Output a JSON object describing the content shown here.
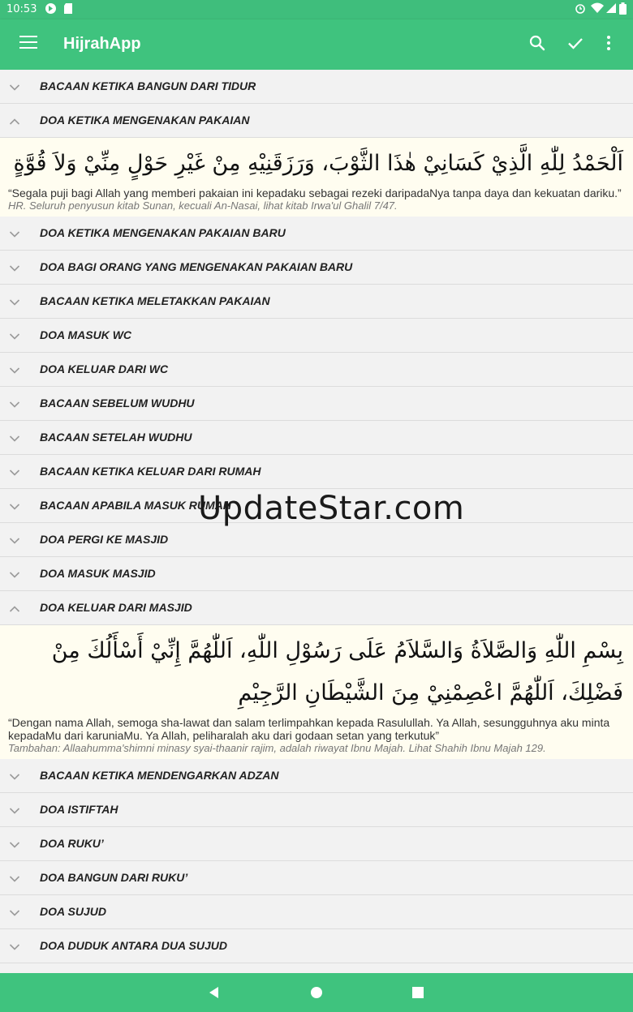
{
  "status_bar": {
    "time": "10:53",
    "icons": [
      "app-icon",
      "sd-card-icon",
      "alarm-icon",
      "wifi-icon",
      "signal-icon",
      "battery-icon"
    ]
  },
  "app_bar": {
    "title": "HijrahApp",
    "actions": [
      "search-icon",
      "check-icon",
      "more-vert-icon"
    ],
    "color": "#3fc37e"
  },
  "items": [
    {
      "label": "BACAAN KETIKA BANGUN DARI TIDUR",
      "expanded": false
    },
    {
      "label": "DOA KETIKA MENGENAKAN PAKAIAN",
      "expanded": true,
      "arabic": "اَلْحَمْدُ لِلّٰهِ الَّذِيْ كَسَانِيْ هٰذَا الثَّوْبَ، وَرَزَقَنِيْهِ مِنْ غَيْرِ حَوْلٍ مِنِّيْ وَلاَ قُوَّةٍ",
      "translation": "“Segala puji bagi Allah yang memberi pakaian ini kepadaku sebagai rezeki daripadaNya tanpa daya dan kekuatan dariku.”",
      "reference": "HR. Seluruh penyusun kitab Sunan, kecuali An-Nasai, lihat kitab Irwa'ul Ghalil 7/47."
    },
    {
      "label": "DOA KETIKA MENGENAKAN PAKAIAN BARU",
      "expanded": false
    },
    {
      "label": "DOA BAGI ORANG YANG MENGENAKAN PAKAIAN BARU",
      "expanded": false
    },
    {
      "label": "BACAAN KETIKA MELETAKKAN PAKAIAN",
      "expanded": false
    },
    {
      "label": "DOA MASUK WC",
      "expanded": false
    },
    {
      "label": "DOA KELUAR DARI WC",
      "expanded": false
    },
    {
      "label": "BACAAN SEBELUM WUDHU",
      "expanded": false
    },
    {
      "label": "BACAAN SETELAH WUDHU",
      "expanded": false
    },
    {
      "label": "BACAAN KETIKA KELUAR DARI RUMAH",
      "expanded": false
    },
    {
      "label": "BACAAN APABILA MASUK RUMAH",
      "expanded": false
    },
    {
      "label": "DOA PERGI KE MASJID",
      "expanded": false
    },
    {
      "label": "DOA MASUK MASJID",
      "expanded": false
    },
    {
      "label": "DOA KELUAR DARI MASJID",
      "expanded": true,
      "arabic": "بِسْمِ اللّٰهِ وَالصَّلاَةُ وَالسَّلاَمُ عَلَى رَسُوْلِ اللّٰهِ، اَللّٰهُمَّ إِنِّيْ أَسْأَلُكَ مِنْ فَضْلِكَ، اَللّٰهُمَّ اعْصِمْنِيْ مِنَ الشَّيْطَانِ الرَّجِيْمِ",
      "translation": "“Dengan nama Allah, semoga sha-lawat dan salam terlimpahkan kepada Rasulullah. Ya Allah, sesungguhnya aku minta kepadaMu dari karuniaMu. Ya Allah, peliharalah aku dari godaan setan yang terkutuk”",
      "reference": "Tambahan: Allaahumma'shimni minasy syai-thaanir rajim, adalah riwayat Ibnu Majah. Lihat Shahih Ibnu Majah 129."
    },
    {
      "label": "BACAAN KETIKA MENDENGARKAN ADZAN",
      "expanded": false
    },
    {
      "label": "DOA ISTIFTAH",
      "expanded": false
    },
    {
      "label": "DOA RUKU’",
      "expanded": false
    },
    {
      "label": "DOA BANGUN DARI RUKU’",
      "expanded": false
    },
    {
      "label": "DOA SUJUD",
      "expanded": false
    },
    {
      "label": "DOA DUDUK ANTARA DUA SUJUD",
      "expanded": false
    }
  ],
  "watermark": "UpdateStar.com",
  "nav_bar": {
    "buttons": [
      "back-icon",
      "home-icon",
      "recents-icon"
    ]
  }
}
